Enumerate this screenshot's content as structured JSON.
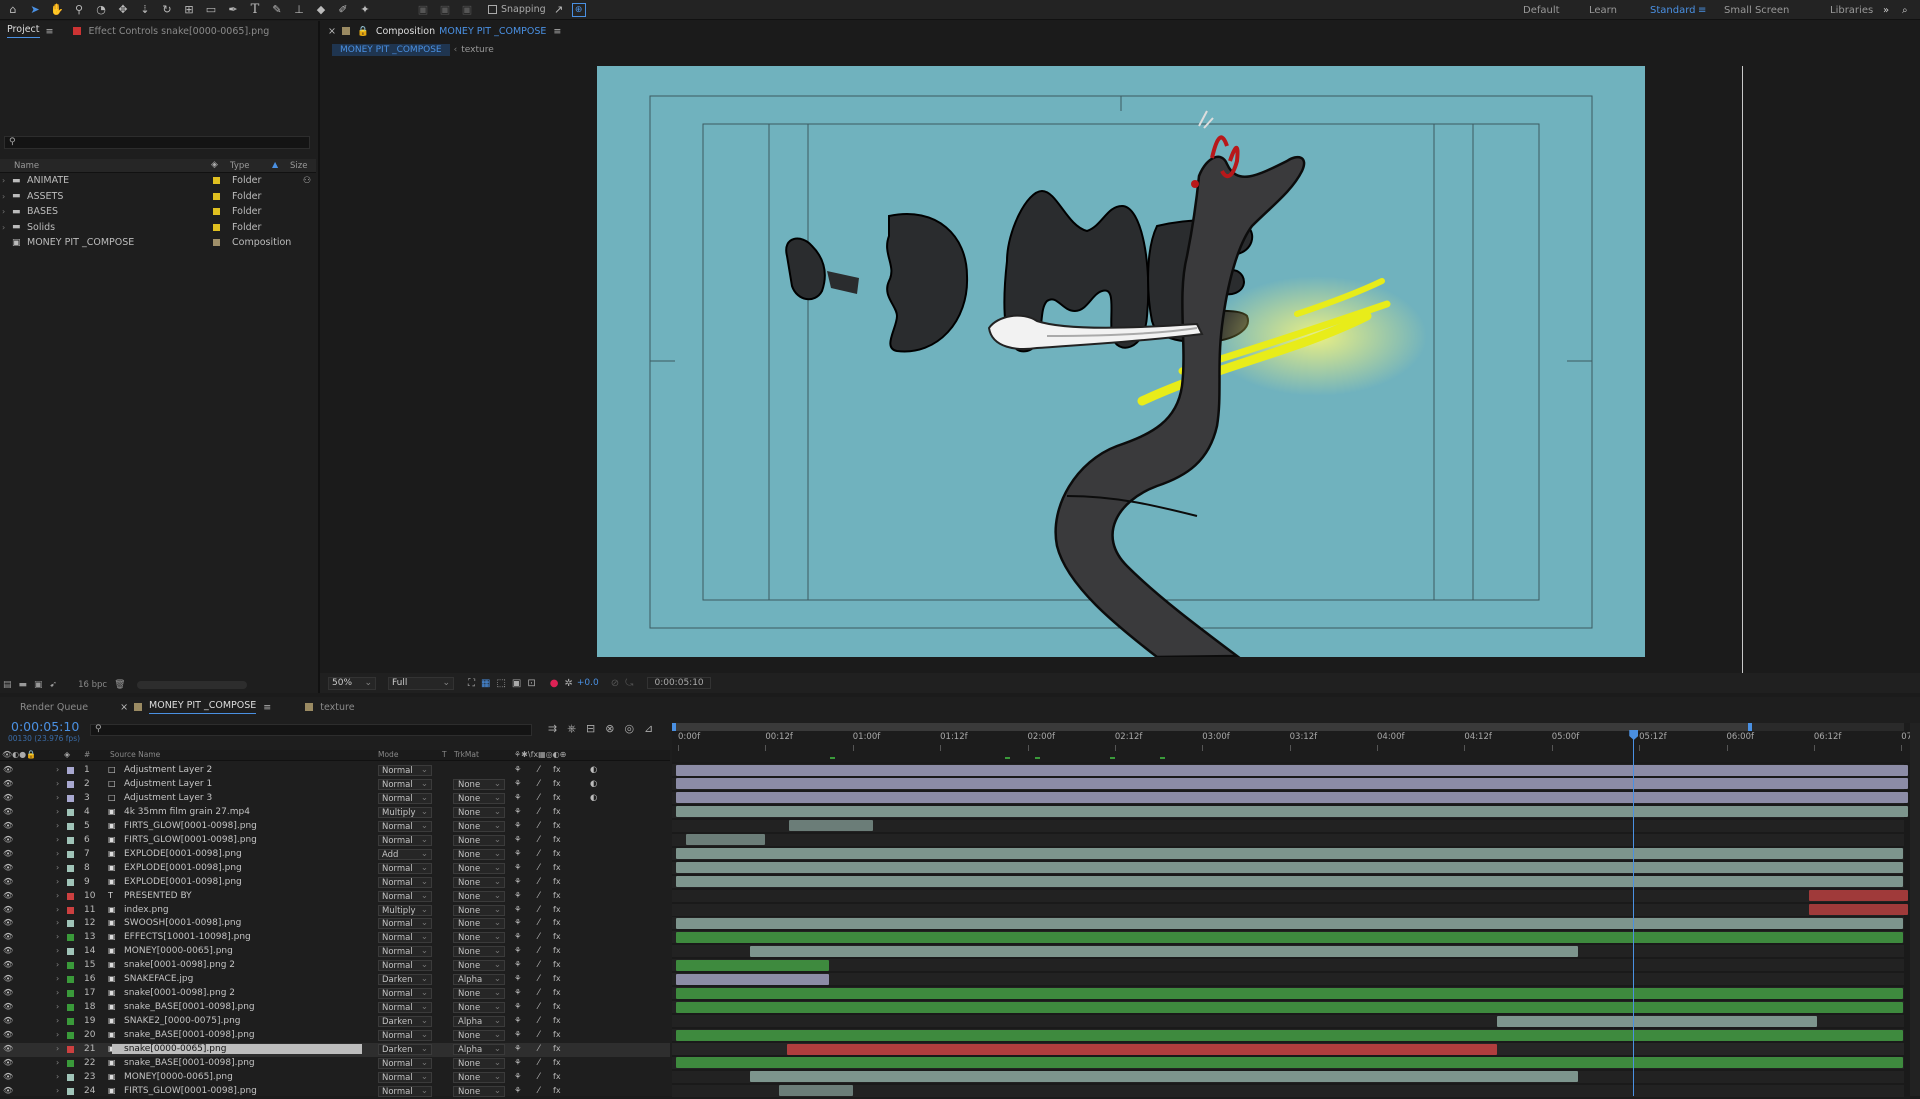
{
  "toolbar": {
    "snapping_label": "Snapping",
    "workspaces": [
      "Default",
      "Learn",
      "Standard",
      "Small Screen",
      "Libraries"
    ],
    "active_workspace": "Standard"
  },
  "project_panel": {
    "tab_project": "Project",
    "tab_effect_controls": "Effect Controls snake[0000-0065].png",
    "col_name": "Name",
    "col_type": "Type",
    "col_size": "Size",
    "items": [
      {
        "name": "ANIMATE",
        "type": "Folder",
        "color": "#e0c020"
      },
      {
        "name": "ASSETS",
        "type": "Folder",
        "color": "#e0c020"
      },
      {
        "name": "BASES",
        "type": "Folder",
        "color": "#e0c020"
      },
      {
        "name": "Solids",
        "type": "Folder",
        "color": "#e0c020"
      },
      {
        "name": "MONEY PIT _COMPOSE",
        "type": "Composition",
        "color": "#a0906a"
      }
    ],
    "bpc": "16 bpc"
  },
  "composition": {
    "tab_prefix": "Composition",
    "comp_name": "MONEY PIT _COMPOSE",
    "breadcrumb_active": "MONEY PIT _COMPOSE",
    "breadcrumb_next": "texture",
    "zoom": "50%",
    "resolution": "Full",
    "exposure": "+0.0",
    "timecode": "0:00:05:10",
    "artwork_text": "-D ME"
  },
  "timeline": {
    "tab_render_queue": "Render Queue",
    "tab_comp": "MONEY PIT _COMPOSE",
    "tab_texture": "texture",
    "current_time": "0:00:05:10",
    "frame_info": "00130 (23.976 fps)",
    "col_num": "#",
    "col_source": "Source Name",
    "col_mode": "Mode",
    "col_t": "T",
    "col_trkmat": "TrkMat",
    "ruler": [
      "0:00f",
      "00:12f",
      "01:00f",
      "01:12f",
      "02:00f",
      "02:12f",
      "03:00f",
      "03:12f",
      "04:00f",
      "04:12f",
      "05:00f",
      "05:12f",
      "06:00f",
      "06:12f",
      "07:0"
    ],
    "layers": [
      {
        "num": "1",
        "name": "Adjustment Layer 2",
        "mode": "Normal",
        "trk": "",
        "color": "#a8a8d0",
        "bar": "#8c8ca6",
        "s": 0.0,
        "e": 1.0
      },
      {
        "num": "2",
        "name": "Adjustment Layer 1",
        "mode": "Normal",
        "trk": "None",
        "color": "#a8a8d0",
        "bar": "#8c8ca6",
        "s": 0.0,
        "e": 1.0
      },
      {
        "num": "3",
        "name": "Adjustment Layer 3",
        "mode": "Normal",
        "trk": "None",
        "color": "#a8a8d0",
        "bar": "#8c8ca6",
        "s": 0.0,
        "e": 1.0
      },
      {
        "num": "4",
        "name": "4k 35mm film grain 27.mp4",
        "mode": "Multiply",
        "trk": "None",
        "color": "#a0c4b8",
        "bar": "#7d958d",
        "s": 0.0,
        "e": 1.0
      },
      {
        "num": "5",
        "name": "FIRTS_GLOW[0001-0098].png",
        "mode": "Normal",
        "trk": "None",
        "color": "#a0c4b8",
        "bar": "#6b7d78",
        "s": 0.092,
        "e": 0.16
      },
      {
        "num": "6",
        "name": "FIRTS_GLOW[0001-0098].png",
        "mode": "Normal",
        "trk": "None",
        "color": "#a0c4b8",
        "bar": "#6b7d78",
        "s": 0.008,
        "e": 0.072
      },
      {
        "num": "7",
        "name": "EXPLODE[0001-0098].png",
        "mode": "Add",
        "trk": "None",
        "color": "#a0c4b8",
        "bar": "#7d958d",
        "s": 0.0,
        "e": 0.996
      },
      {
        "num": "8",
        "name": "EXPLODE[0001-0098].png",
        "mode": "Normal",
        "trk": "None",
        "color": "#a0c4b8",
        "bar": "#7d958d",
        "s": 0.0,
        "e": 0.996
      },
      {
        "num": "9",
        "name": "EXPLODE[0001-0098].png",
        "mode": "Normal",
        "trk": "None",
        "color": "#a0c4b8",
        "bar": "#7d958d",
        "s": 0.0,
        "e": 0.996
      },
      {
        "num": "10",
        "name": "PRESENTED BY",
        "mode": "Normal",
        "trk": "None",
        "color": "#cc4040",
        "bar": "#a03a3a",
        "s": 0.92,
        "e": 1.0
      },
      {
        "num": "11",
        "name": "index.png",
        "mode": "Multiply",
        "trk": "None",
        "color": "#cc4040",
        "bar": "#a03a3a",
        "s": 0.92,
        "e": 1.0
      },
      {
        "num": "12",
        "name": "SWOOSH[0001-0098].png",
        "mode": "Normal",
        "trk": "None",
        "color": "#a0c4b8",
        "bar": "#7d958d",
        "s": 0.0,
        "e": 0.996
      },
      {
        "num": "13",
        "name": "EFFECTS[10001-10098].png",
        "mode": "Normal",
        "trk": "None",
        "color": "#3a9a3a",
        "bar": "#3e8a3e",
        "s": 0.0,
        "e": 0.996
      },
      {
        "num": "14",
        "name": "MONEY[0000-0065].png",
        "mode": "Normal",
        "trk": "None",
        "color": "#a0c4b8",
        "bar": "#7d958d",
        "s": 0.06,
        "e": 0.732
      },
      {
        "num": "15",
        "name": "snake[0001-0098].png 2",
        "mode": "Normal",
        "trk": "None",
        "color": "#3a9a3a",
        "bar": "#3e8a3e",
        "s": 0.0,
        "e": 0.124
      },
      {
        "num": "16",
        "name": "SNAKEFACE.jpg",
        "mode": "Darken",
        "trk": "Alpha",
        "color": "#3a9a3a",
        "bar": "#8c8ca6",
        "s": 0.0,
        "e": 0.124
      },
      {
        "num": "17",
        "name": "snake[0001-0098].png 2",
        "mode": "Normal",
        "trk": "None",
        "color": "#3a9a3a",
        "bar": "#3e8a3e",
        "s": 0.0,
        "e": 0.996
      },
      {
        "num": "18",
        "name": "snake_BASE[0001-0098].png",
        "mode": "Normal",
        "trk": "None",
        "color": "#3a9a3a",
        "bar": "#3e8a3e",
        "s": 0.0,
        "e": 0.996
      },
      {
        "num": "19",
        "name": "SNAKE2_[0000-0075].png",
        "mode": "Darken",
        "trk": "Alpha",
        "color": "#3a9a3a",
        "bar": "#7d958d",
        "s": 0.666,
        "e": 0.926
      },
      {
        "num": "20",
        "name": "snake_BASE[0001-0098].png",
        "mode": "Normal",
        "trk": "None",
        "color": "#3a9a3a",
        "bar": "#3e8a3e",
        "s": 0.0,
        "e": 0.996
      },
      {
        "num": "21",
        "name": "snake[0000-0065].png",
        "mode": "Darken",
        "trk": "Alpha",
        "color": "#cc4040",
        "bar": "#b03e3e",
        "s": 0.09,
        "e": 0.666
      },
      {
        "num": "22",
        "name": "snake_BASE[0001-0098].png",
        "mode": "Normal",
        "trk": "None",
        "color": "#3a9a3a",
        "bar": "#3e8a3e",
        "s": 0.0,
        "e": 0.996
      },
      {
        "num": "23",
        "name": "MONEY[0000-0065].png",
        "mode": "Normal",
        "trk": "None",
        "color": "#a0c4b8",
        "bar": "#7d958d",
        "s": 0.06,
        "e": 0.732
      },
      {
        "num": "24",
        "name": "FIRTS_GLOW[0001-0098].png",
        "mode": "Normal",
        "trk": "None",
        "color": "#a0c4b8",
        "bar": "#6b7d78",
        "s": 0.084,
        "e": 0.144
      }
    ],
    "selected_layer": "21",
    "playhead_fraction": 0.777
  }
}
